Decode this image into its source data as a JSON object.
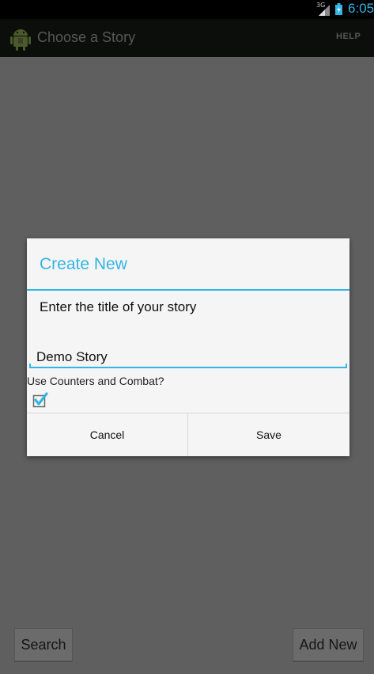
{
  "status_bar": {
    "network_label": "3G",
    "time": "6:05",
    "icons": [
      "signal-icon",
      "battery-charging-icon"
    ]
  },
  "action_bar": {
    "title": "Choose a Story",
    "help_label": "HELP",
    "icon": "android-app-icon"
  },
  "dialog": {
    "title": "Create New",
    "message": "Enter the title of your story",
    "story_title_value": "Demo Story",
    "combat_label": "Use Counters and Combat?",
    "combat_checked": true,
    "cancel_label": "Cancel",
    "save_label": "Save"
  },
  "bottom": {
    "search_label": "Search",
    "add_new_label": "Add New"
  },
  "colors": {
    "accent": "#33b5e5",
    "dim_background": "#5f5f5f",
    "dialog_background": "#f5f5f5"
  }
}
